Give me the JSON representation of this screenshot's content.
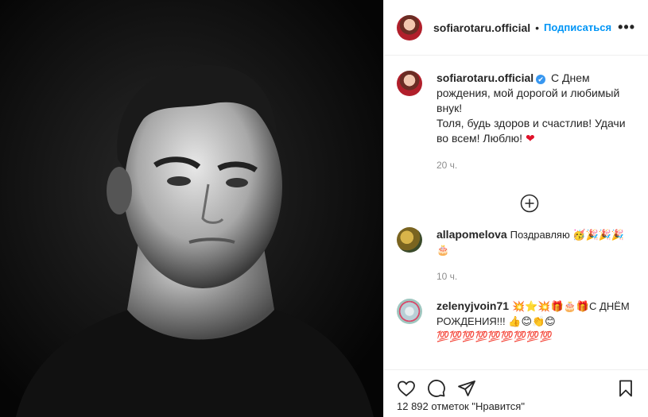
{
  "post": {
    "username": "sofiarotaru.official",
    "follow_label": "Подписаться",
    "separator": "•",
    "more_label": "•••"
  },
  "caption": {
    "username": "sofiarotaru.official",
    "verified_mark": "✔",
    "line1": "С Днем рождения, мой дорогой и любимый внук!",
    "line2": "Толя, будь здоров и счастлив! Удачи во всем! Люблю!",
    "heart": "❤",
    "time": "20 ч."
  },
  "comments": [
    {
      "username": "allapomelova",
      "text": "Поздравляю 🥳🎉🎉🎉🎂",
      "time": "10 ч."
    },
    {
      "username": "zelenyjvoin71",
      "text": "💥⭐💥🎁🎂🎁С ДНЁМ РОЖДЕНИЯ!!! 👍😊👏😊",
      "extra": "💯💯💯💯💯💯💯💯💯"
    }
  ],
  "likes": {
    "text": "12 892 отметок \"Нравится\""
  },
  "icons": {
    "like": "heart-icon",
    "comment": "comment-icon",
    "share": "share-icon",
    "save": "bookmark-icon",
    "load_more": "plus-circle-icon"
  },
  "colors": {
    "accent": "#0095f6",
    "verified": "#3897f0",
    "muted": "#8e8e8e",
    "heart": "#e0122a"
  }
}
